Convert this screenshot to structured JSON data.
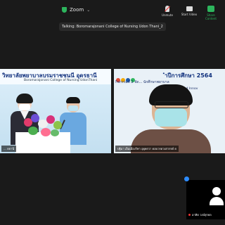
{
  "topbar": {
    "brand": "Zoom",
    "controls": [
      {
        "label": "Unmute",
        "icon": "microphone-muted-icon"
      },
      {
        "label": "Start Video",
        "icon": "video-icon"
      },
      {
        "label": "Share Content",
        "icon": "share-screen-icon"
      }
    ]
  },
  "sharing_banner": "Talking: Boromarajonani College of Nursing Udon Thani_2",
  "left_tile": {
    "title_thai": "วิทยาลัยพยาบาลบรมราชชนนี อุดรธานี",
    "title_eng": "Boromarajonani College of Nursing UdonThani",
    "name_label": "... ดธานี"
  },
  "right_tile": {
    "title_year": "ำปีการศึกษา 2564",
    "line1": "กิจกรรมที่ 2 จัด...                    นักศึกษาพยาบาล",
    "line2": "Jsua...                    Research and Innov",
    "name_label": "ปฐิมา เอ็มเมืองวิทา อุยุคกวา ดอบวรดวงสวรรค์ ย"
  },
  "self_view": {
    "name_label": "อาทิต วงษ์สุรพล"
  },
  "colors": {
    "accent_green": "#2db55d",
    "self_dot_blue": "#2d8cff",
    "mute_red": "#e33333"
  }
}
